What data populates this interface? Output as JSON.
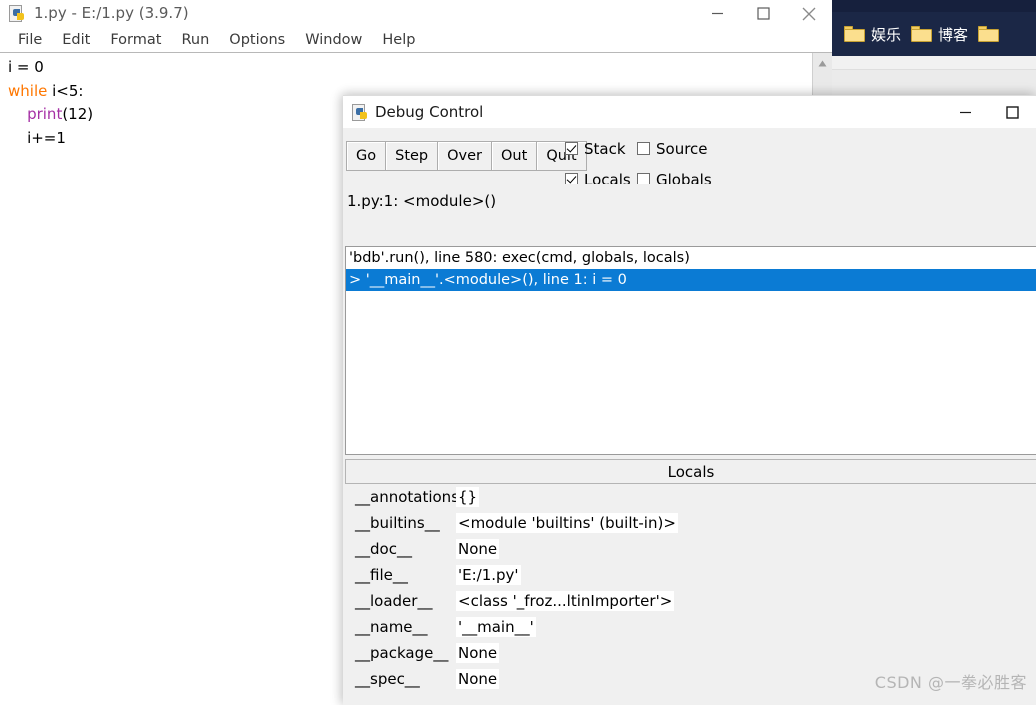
{
  "browser": {
    "bookmarks": [
      {
        "icon": "folder-icon",
        "label": "娱乐"
      },
      {
        "icon": "folder-icon",
        "label": "博客"
      },
      {
        "icon": "folder-icon",
        "label": ""
      }
    ],
    "bar_color": "#1b2746"
  },
  "idle": {
    "title": "1.py - E:/1.py (3.9.7)",
    "icon": "python-file-icon",
    "menus": [
      "File",
      "Edit",
      "Format",
      "Run",
      "Options",
      "Window",
      "Help"
    ],
    "window_controls": {
      "minimize": "minimize-icon",
      "maximize": "maximize-icon",
      "close": "close-icon"
    },
    "code": {
      "line1_a": "i = 0",
      "line2_kw": "while",
      "line2_b": " i<5:",
      "line3_indent": "    ",
      "line3_fn": "print",
      "line3_b": "(12)",
      "line4": "    i+=1"
    },
    "scrollbar": "scroll-up-arrow"
  },
  "debug": {
    "title": "Debug Control",
    "icon": "python-file-icon",
    "window_controls": {
      "minimize": "minimize-icon",
      "maximize": "maximize-icon"
    },
    "buttons": [
      "Go",
      "Step",
      "Over",
      "Out",
      "Quit"
    ],
    "checkboxes": [
      {
        "label": "Stack",
        "checked": true
      },
      {
        "label": "Source",
        "checked": false
      },
      {
        "label": "Locals",
        "checked": true
      },
      {
        "label": "Globals",
        "checked": false
      }
    ],
    "status": "1.py:1: <module>()",
    "stack": [
      {
        "text": "'bdb'.run(), line 580: exec(cmd, globals, locals)",
        "selected": false
      },
      {
        "text": "> '__main__'.<module>(), line 1: i = 0",
        "selected": true
      }
    ],
    "locals_header": "Locals",
    "locals": [
      {
        "name": "__annotations__",
        "value": "{}"
      },
      {
        "name": "__builtins__",
        "value": "<module 'builtins' (built-in)>"
      },
      {
        "name": "__doc__",
        "value": "None"
      },
      {
        "name": "__file__",
        "value": "'E:/1.py'"
      },
      {
        "name": "__loader__",
        "value": "<class '_froz...ltinImporter'>"
      },
      {
        "name": "__name__",
        "value": "'__main__'"
      },
      {
        "name": "__package__",
        "value": "None"
      },
      {
        "name": "__spec__",
        "value": "None"
      }
    ],
    "selection_color": "#0b7bd4"
  },
  "watermark": "CSDN @一拳必胜客"
}
